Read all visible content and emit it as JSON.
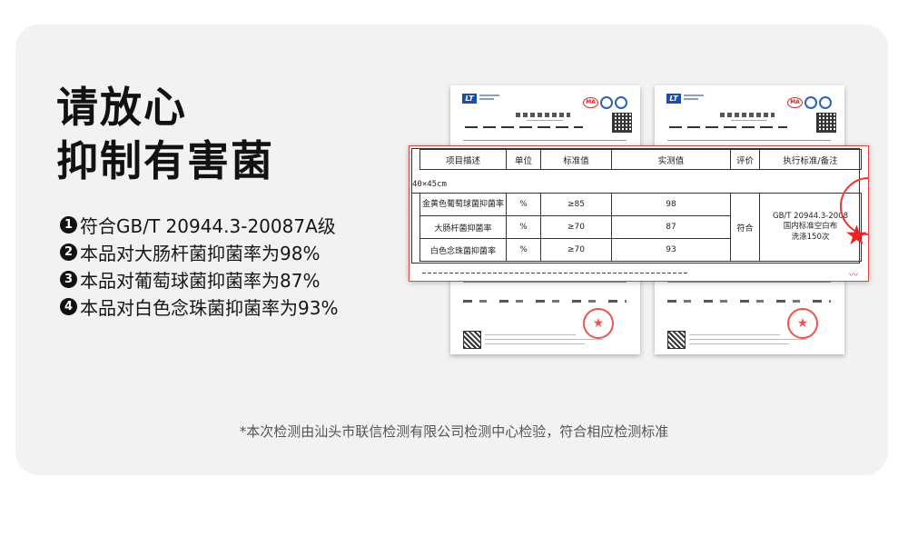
{
  "headline": {
    "line1": "请放心",
    "line2": "抑制有害菌"
  },
  "claims": [
    {
      "num": "1",
      "text": "符合GB/T 20944.3-20087A级"
    },
    {
      "num": "2",
      "text": "本品对大肠杆菌抑菌率为98%"
    },
    {
      "num": "3",
      "text": "本品对葡萄球菌抑菌率为87%"
    },
    {
      "num": "4",
      "text": "本品对白色念珠菌抑菌率为93%"
    }
  ],
  "zoom_table": {
    "headers": [
      "项目描述",
      "单位",
      "标准值",
      "实测值",
      "评价",
      "执行标准/备注"
    ],
    "size_note": "40×45cm",
    "rows": [
      {
        "item": "金黄色葡萄球菌抑菌率",
        "unit": "%",
        "standard": "≥85",
        "measured": "98"
      },
      {
        "item": "大肠杆菌抑菌率",
        "unit": "%",
        "standard": "≥70",
        "measured": "87"
      },
      {
        "item": "白色念珠菌抑菌率",
        "unit": "%",
        "standard": "≥70",
        "measured": "93"
      }
    ],
    "evaluation": "符合",
    "note_standard": "GB/T 20944.3-2008",
    "note_line2": "国内标准空白布",
    "note_line3": "洗涤150次"
  },
  "report": {
    "logo": "LT",
    "cert_mark": "MA"
  },
  "footer": "*本次检测由汕头市联信检测有限公司检测中心检验，符合相应检测标准",
  "colors": {
    "panel_bg": "#f2f2f2",
    "callout_border": "#e04444",
    "stamp_red": "#e33333",
    "logo_blue": "#1c4ea8"
  }
}
